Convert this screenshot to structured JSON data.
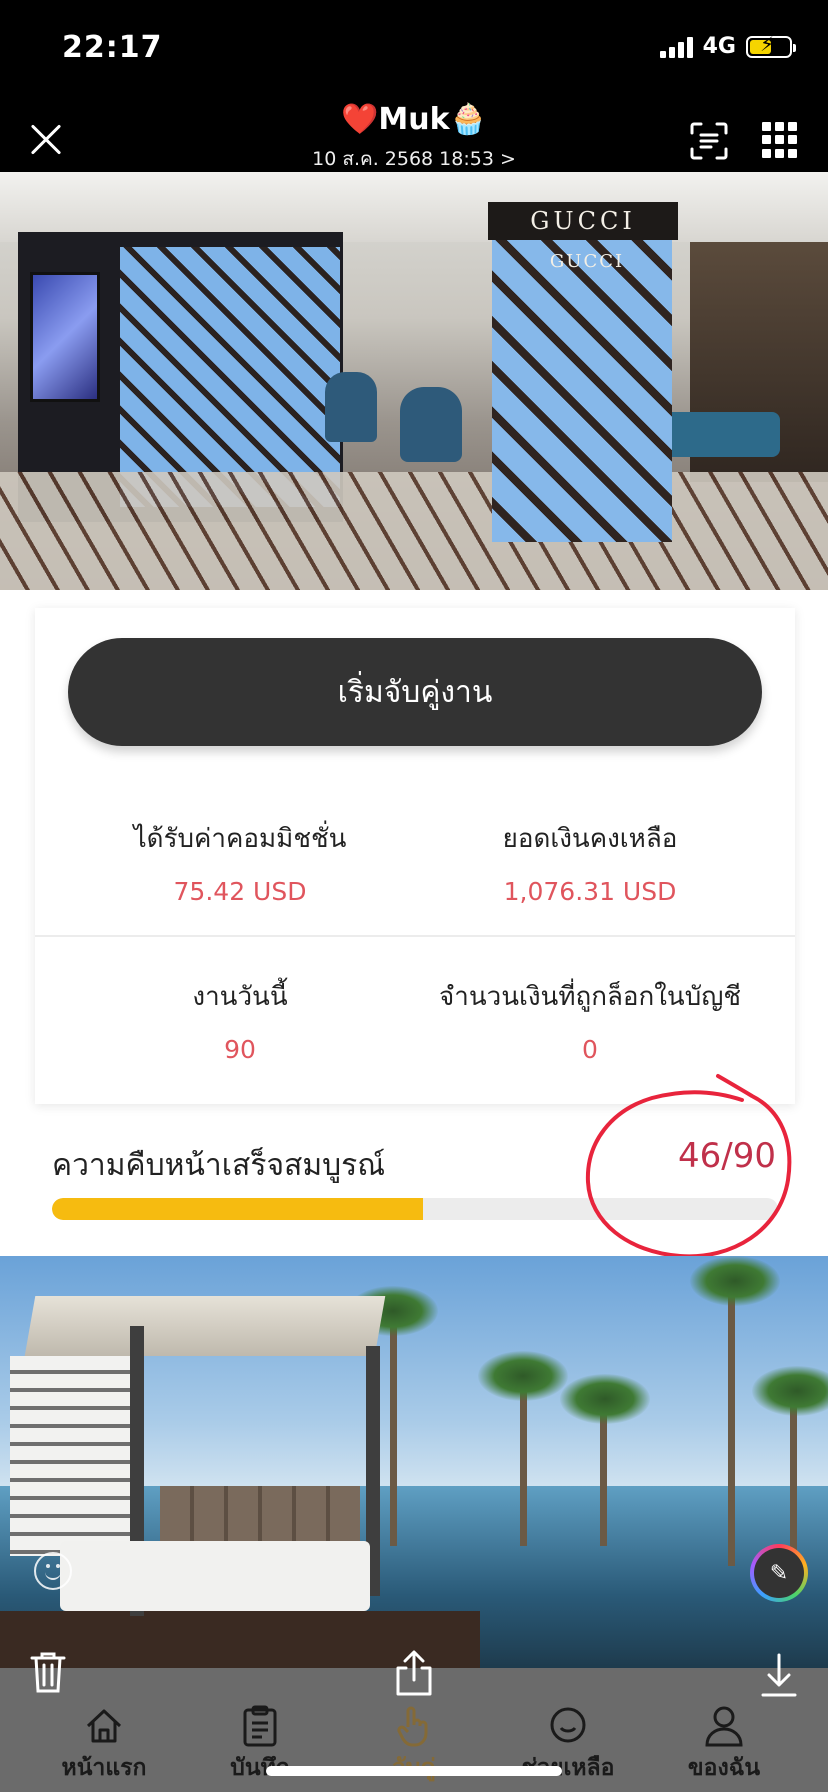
{
  "status_bar": {
    "time": "22:17",
    "network": "4G",
    "battery_charging": true
  },
  "viewer": {
    "sender_name": "Muk",
    "sender_prefix_emoji": "❤️",
    "sender_suffix_emoji": "🧁",
    "timestamp": "10 ส.ค. 2568 18:53 >"
  },
  "store_photo": {
    "sign_left": "GUCCI",
    "sign_right": "GUCCI"
  },
  "task": {
    "start_button_label": "เริ่มจับคู่งาน",
    "commission_label": "ได้รับค่าคอมมิชชั่น",
    "commission_value": "75.42 USD",
    "balance_label": "ยอดเงินคงเหลือ",
    "balance_value": "1,076.31 USD",
    "today_tasks_label": "งานวันนี้",
    "today_tasks_value": "90",
    "locked_amount_label": "จำนวนเงินที่ถูกล็อกในบัญชี",
    "locked_amount_value": "0",
    "progress_label": "ความคืบหน้าเสร็จสมบูรณ์",
    "progress_text": "46/90",
    "progress_fraction": 0.511,
    "progress_color": "#f6bb10",
    "value_color": "#e0555d",
    "annotation_color": "#e8243c"
  },
  "tabbar": {
    "items": [
      {
        "label": "หน้าแรก",
        "icon": "home-icon"
      },
      {
        "label": "บันทึก",
        "icon": "clipboard-icon"
      },
      {
        "label": "จับคู่",
        "icon": "hand-pointer-icon",
        "active": true
      },
      {
        "label": "ช่วยเหลือ",
        "icon": "chat-smile-icon"
      },
      {
        "label": "ของฉัน",
        "icon": "person-icon"
      }
    ]
  }
}
